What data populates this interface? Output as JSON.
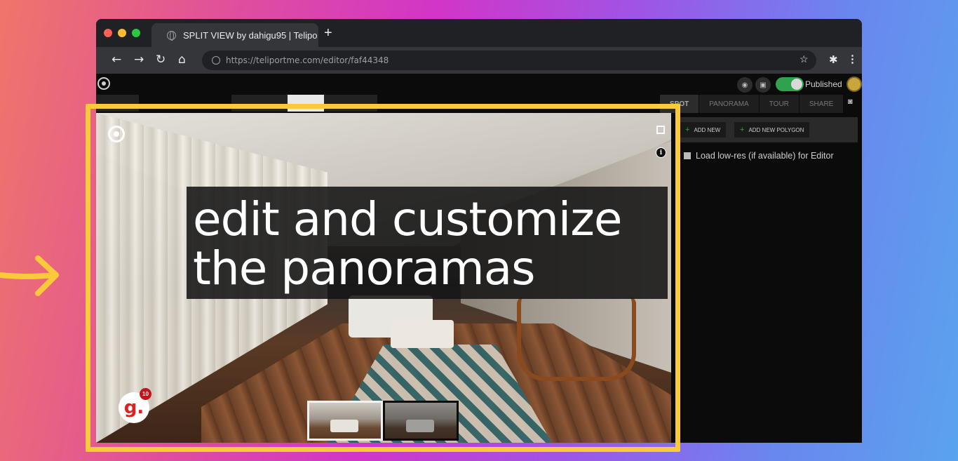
{
  "browser": {
    "tab_title": "SPLIT VIEW by dahigu95 | Telipo",
    "new_tab_label": "+",
    "url": "https://teliportme.com/editor/faf44348"
  },
  "app": {
    "published_label": "Published",
    "left_tabs": [
      "",
      "",
      "",
      ""
    ],
    "right_tabs": [
      "SPOT",
      "PANORAMA",
      "TOUR",
      "SHARE"
    ],
    "add_new_label": "ADD NEW",
    "add_polygon_label": "ADD NEW POLYGON",
    "lowres_label": "Load low-res (if available) for Editor"
  },
  "viewer": {
    "overlay_line1": "edit and customize",
    "overlay_line2": "the panoramas",
    "badge_letter": "g.",
    "badge_count": "10",
    "info_label": "i"
  },
  "colors": {
    "highlight": "#fcc93a",
    "toggle_on": "#2fa24e",
    "badge": "#c0151b"
  },
  "icons": [
    "arrow-right-icon",
    "back-icon",
    "forward-icon",
    "reload-icon",
    "home-icon",
    "star-icon",
    "extensions-icon",
    "menu-icon",
    "eye-icon",
    "save-icon",
    "camera-icon",
    "fullscreen-icon",
    "info-icon"
  ]
}
